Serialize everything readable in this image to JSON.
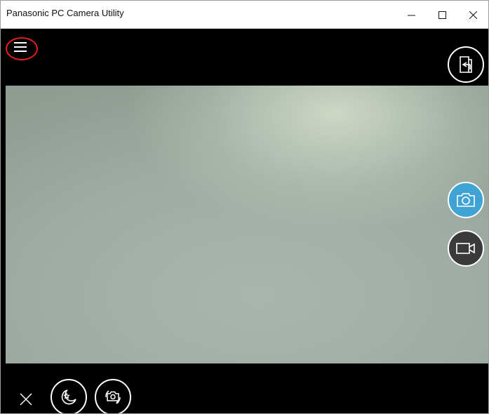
{
  "window": {
    "title": "Panasonic PC Camera Utility",
    "controls": [
      "minimize-icon",
      "maximize-icon",
      "close-icon"
    ]
  },
  "toolbar": {
    "menu_icon": "hamburger-menu-icon",
    "export_icon": "export-to-folder-icon"
  },
  "capture": {
    "photo_icon": "camera-icon",
    "video_icon": "video-camera-icon",
    "active_mode": "photo"
  },
  "bottom": {
    "close_icon": "close-icon",
    "night_mode_icon": "night-mode-icon",
    "switch_camera_icon": "switch-camera-icon"
  },
  "colors": {
    "photo_button": "#3fa3d4",
    "video_button": "#3a3a3a",
    "highlight_ring": "#e0201f",
    "bars": "#000000"
  }
}
